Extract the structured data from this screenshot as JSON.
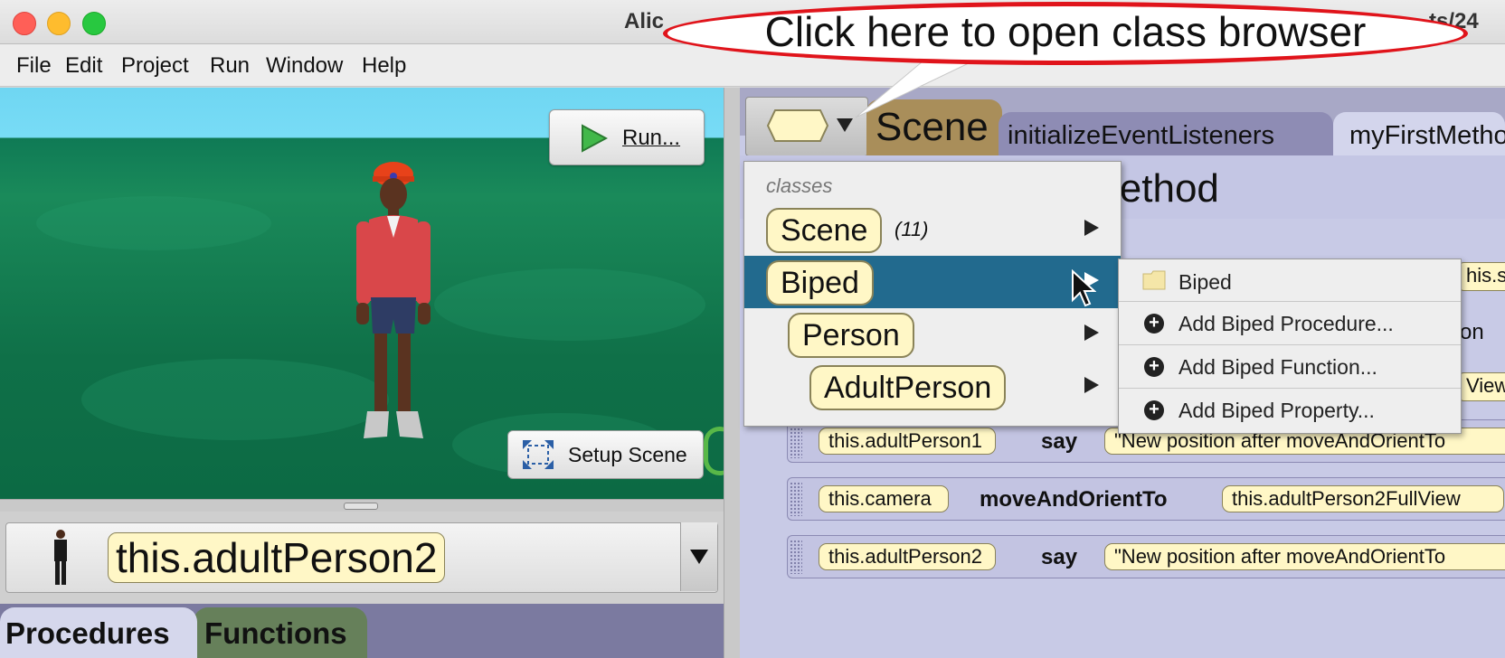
{
  "window": {
    "title_left": "Alic",
    "title_right": "ts/24"
  },
  "menu": [
    "File",
    "Edit",
    "Project",
    "Run",
    "Window",
    "Help"
  ],
  "scene_view": {
    "run_label": "Run...",
    "setup_label": "Setup Scene"
  },
  "instance_selector": {
    "value": "this.adultPerson2"
  },
  "left_tabs": {
    "procedures": "Procedures",
    "functions": "Functions"
  },
  "editor_tabs": {
    "scene": "Scene",
    "init": "initializeEventListeners",
    "myfirst": "myFirstMetho"
  },
  "method_header": "lethod",
  "statements": [
    {
      "target": "this.adultPerson1",
      "verb": "say",
      "arg": "\"New position after moveAndOrientTo"
    },
    {
      "target": "this.camera",
      "verb": "moveAndOrientTo",
      "arg": "this.adultPerson2FullView"
    },
    {
      "target": "this.adultPerson2",
      "verb": "say",
      "arg": "\"New position after moveAndOrientTo"
    }
  ],
  "partial_right": {
    "r1": "his.s",
    "r2": "on",
    "r3": "View"
  },
  "class_menu": {
    "header": "classes",
    "items": [
      {
        "label": "Scene",
        "count": "(11)"
      },
      {
        "label": "Biped",
        "count": ""
      },
      {
        "label": "Person",
        "count": ""
      },
      {
        "label": "AdultPerson",
        "count": ""
      }
    ]
  },
  "submenu": {
    "folder": "Biped",
    "items": [
      "Add Biped Procedure...",
      "Add Biped Function...",
      "Add Biped Property..."
    ]
  },
  "callout": "Click here to open class browser",
  "colors": {
    "selected_row": "#226a8e",
    "callout_border": "#e0141b",
    "tile": "#fff7c6"
  }
}
